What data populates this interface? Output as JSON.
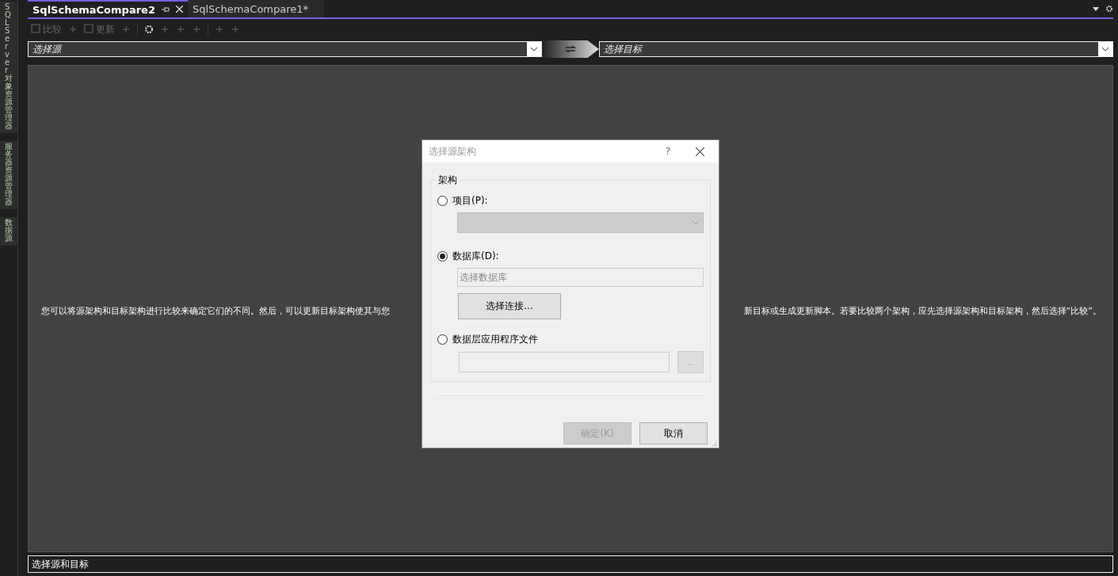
{
  "side_tabs": [
    {
      "label": "SQL Server 对象资源管理器"
    },
    {
      "label": "服务器资源管理器"
    },
    {
      "label": "数据源"
    }
  ],
  "tabs": [
    {
      "label": "SqlSchemaCompare2",
      "selected": true
    },
    {
      "label": "SqlSchemaCompare1*",
      "selected": false
    }
  ],
  "toolbar": [
    {
      "kind": "icon-text",
      "label": "比较",
      "disabled": true
    },
    {
      "kind": "icon",
      "disabled": true
    },
    {
      "kind": "icon-text",
      "label": "更新",
      "disabled": true
    },
    {
      "kind": "icon",
      "disabled": true
    },
    {
      "kind": "separator"
    },
    {
      "kind": "icon",
      "disabled": false
    },
    {
      "kind": "icon",
      "disabled": true
    },
    {
      "kind": "icon",
      "disabled": true
    },
    {
      "kind": "icon",
      "disabled": true
    },
    {
      "kind": "separator"
    },
    {
      "kind": "icon",
      "disabled": true
    },
    {
      "kind": "icon",
      "disabled": true
    }
  ],
  "source": {
    "value": "选择源"
  },
  "target": {
    "value": "选择目标"
  },
  "message": {
    "left": "您可以将源架构和目标架构进行比较来确定它们的不同。然后，可以更新目标架构使其与您",
    "right": "新目标或生成更新脚本。若要比较两个架构，应先选择源架构和目标架构，然后选择“比较”。"
  },
  "dialog": {
    "title": "选择源架构",
    "help": "?",
    "group": "架构",
    "options": [
      {
        "kind": "dropdown",
        "label": "项目(P):",
        "selected": false
      },
      {
        "kind": "database",
        "label": "数据库(D):",
        "selected": true,
        "placeholder": "选择数据库",
        "button": "选择连接..."
      },
      {
        "kind": "file",
        "label": "数据层应用程序文件",
        "selected": false,
        "button": "..."
      }
    ],
    "buttons": [
      {
        "label": "确定(K)",
        "disabled": true
      },
      {
        "label": "取消",
        "disabled": false
      }
    ]
  },
  "status_bar": "选择源和目标"
}
